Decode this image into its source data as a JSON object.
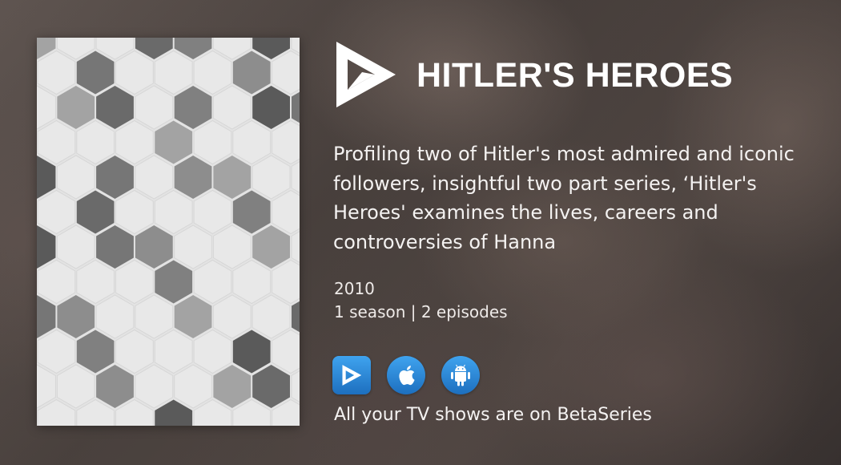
{
  "show": {
    "title": "HITLER'S HEROES",
    "description": "Profiling two of Hitler's most admired and iconic followers, insightful two part series, ‘Hitler's Heroes' examines the lives, careers and controversies of Hanna",
    "year": "2010",
    "seasons_episodes": "1 season | 2 episodes"
  },
  "apps": [
    {
      "name": "betaseries-app-icon"
    },
    {
      "name": "apple-icon"
    },
    {
      "name": "android-icon"
    }
  ],
  "tagline": "All your TV shows are on BetaSeries",
  "colors": {
    "app_button": "#2b86d6",
    "poster_bg": "#e3e3e3",
    "text": "#ffffff"
  }
}
